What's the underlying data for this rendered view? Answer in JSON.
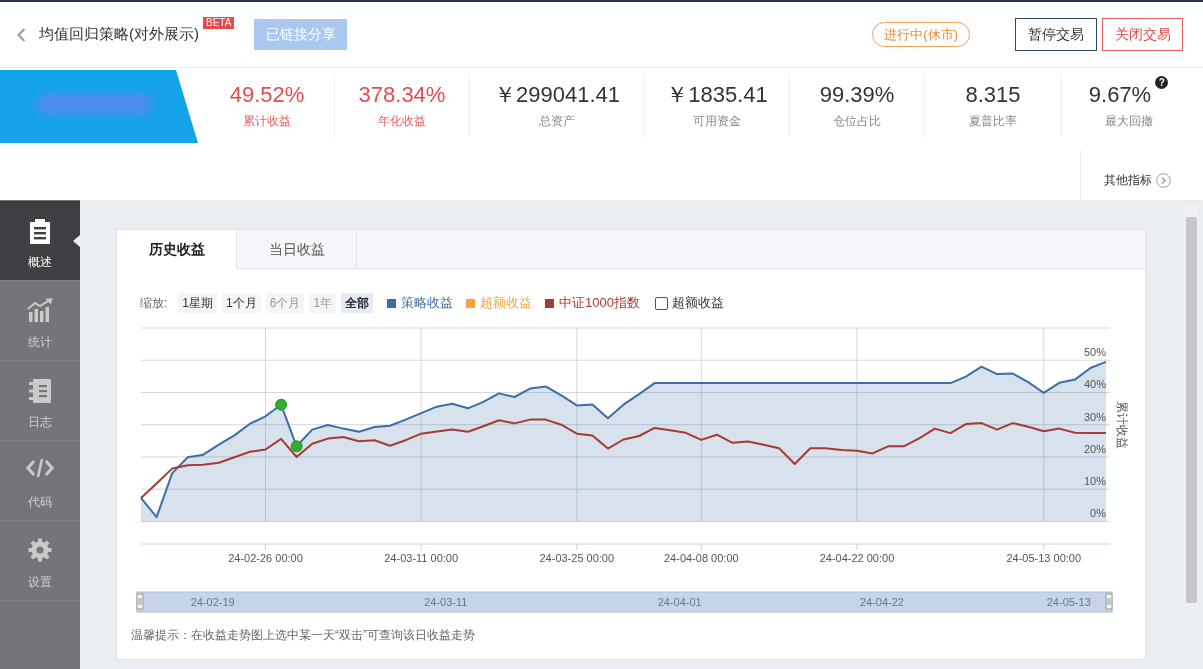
{
  "header": {
    "title": "均值回归策略(对外展示)",
    "badge": "BETA",
    "share_button": "已链接分享",
    "status": "进行中(休市)",
    "buttons": [
      {
        "label": "暂停交易",
        "kind": "outline"
      },
      {
        "label": "关闭交易",
        "kind": "danger"
      }
    ]
  },
  "metrics": [
    {
      "value": "49.52%",
      "label": "累计收益",
      "highlight": true
    },
    {
      "value": "378.34%",
      "label": "年化收益",
      "highlight": true
    },
    {
      "value": "￥299041.41",
      "label": "总资产",
      "highlight": false
    },
    {
      "value": "￥1835.41",
      "label": "可用资金",
      "highlight": false
    },
    {
      "value": "99.39%",
      "label": "仓位占比",
      "highlight": false
    },
    {
      "value": "8.315",
      "label": "夏普比率",
      "highlight": false
    },
    {
      "value": "9.67%",
      "label": "最大回撤",
      "highlight": false,
      "help": "?"
    }
  ],
  "other_metrics": "其他指标",
  "sidebar": [
    {
      "label": "概述",
      "selected": true
    },
    {
      "label": "统计",
      "selected": false
    },
    {
      "label": "日志",
      "selected": false
    },
    {
      "label": "代码",
      "selected": false
    },
    {
      "label": "设置",
      "selected": false
    }
  ],
  "chart_panel": {
    "tabs": [
      {
        "label": "历史收益",
        "selected": true
      },
      {
        "label": "当日收益",
        "selected": false
      }
    ],
    "zoom_label": "缩放:",
    "zoom_options": [
      {
        "label": "1星期",
        "selected": false,
        "disabled": false
      },
      {
        "label": "1个月",
        "selected": false,
        "disabled": false
      },
      {
        "label": "6个月",
        "selected": false,
        "disabled": true
      },
      {
        "label": "1年",
        "selected": false,
        "disabled": true
      },
      {
        "label": "全部",
        "selected": true,
        "disabled": false
      }
    ],
    "toggle": {
      "label": "超额收益",
      "checked": false
    },
    "chart_data": {
      "type": "line",
      "ylabel": "累计收益",
      "grid": true,
      "categories": [
        null,
        null,
        null,
        null,
        null,
        null,
        null,
        null,
        "24-02-26 00:00",
        null,
        null,
        null,
        null,
        null,
        null,
        null,
        null,
        null,
        "24-03-11 00:00",
        null,
        null,
        null,
        null,
        null,
        null,
        null,
        null,
        null,
        "24-03-25 00:00",
        null,
        null,
        null,
        null,
        null,
        null,
        null,
        "24-04-08 00:00",
        null,
        null,
        null,
        null,
        null,
        null,
        null,
        null,
        null,
        "24-04-22 00:00",
        null,
        null,
        null,
        null,
        null,
        null,
        null,
        null,
        null,
        null,
        null,
        "24-05-13 00:00",
        null,
        null,
        null,
        null
      ],
      "series": [
        {
          "name": "策略收益",
          "color": "#3d6ea5",
          "type": "area",
          "values": [
            7.3,
            1.3,
            14.9,
            19.9,
            20.7,
            23.8,
            26.7,
            30.3,
            32.6,
            36.2,
            23.3,
            28.5,
            29.9,
            28.8,
            27.8,
            29.3,
            29.7,
            31.6,
            33.6,
            35.6,
            36.5,
            35.1,
            37.1,
            39.7,
            38.6,
            41.2,
            41.9,
            39.1,
            36.0,
            36.3,
            32.0,
            36.2,
            39.5,
            42.9,
            42.9,
            42.9,
            42.9,
            42.9,
            42.9,
            42.9,
            42.9,
            42.9,
            42.9,
            42.9,
            42.9,
            42.9,
            42.9,
            42.9,
            42.9,
            42.9,
            42.9,
            42.9,
            42.9,
            44.9,
            48.0,
            45.7,
            45.9,
            43.2,
            39.9,
            43.0,
            44.0,
            47.6,
            49.5
          ]
        },
        {
          "name": "超额收益",
          "color": "#f2a43a",
          "type": "line",
          "values": [
            null,
            null,
            null,
            null,
            null,
            null,
            null,
            null,
            null,
            null,
            null,
            null,
            null,
            null,
            null,
            null,
            null,
            null,
            null,
            null,
            null,
            null,
            null,
            null,
            null,
            null,
            null,
            null,
            null,
            null,
            null,
            null,
            null,
            null,
            null,
            null,
            null,
            null,
            null,
            null,
            null,
            null,
            null,
            null,
            null,
            null,
            null,
            null,
            null,
            null,
            null,
            null,
            null,
            null,
            null,
            null,
            null,
            null,
            null,
            null,
            null,
            null,
            null
          ]
        },
        {
          "name": "中证1000指数",
          "color": "#a63a35",
          "type": "line",
          "values": [
            7.3,
            11.8,
            16.4,
            17.4,
            17.6,
            18.2,
            19.9,
            21.6,
            22.3,
            25.6,
            20.0,
            24.1,
            25.7,
            26.2,
            24.9,
            25.2,
            23.5,
            25.2,
            27.2,
            27.9,
            28.5,
            27.8,
            29.5,
            31.4,
            30.4,
            31.6,
            31.6,
            30.0,
            27.2,
            26.7,
            22.6,
            25.4,
            26.5,
            29.0,
            28.3,
            27.5,
            25.3,
            26.9,
            24.4,
            24.8,
            23.8,
            22.7,
            17.8,
            22.7,
            22.7,
            22.2,
            21.9,
            21.1,
            23.3,
            23.3,
            25.8,
            28.8,
            27.4,
            30.2,
            30.5,
            28.5,
            30.5,
            29.4,
            28.0,
            28.8,
            27.5,
            27.4,
            27.4
          ]
        }
      ],
      "ylim": [
        -7,
        60
      ],
      "yticks": [
        {
          "value": 0,
          "label": "0%"
        },
        {
          "value": 10,
          "label": "10%"
        },
        {
          "value": 20,
          "label": "20%"
        },
        {
          "value": 30,
          "label": "30%"
        },
        {
          "value": 40,
          "label": "40%"
        },
        {
          "value": 50,
          "label": "50%"
        }
      ]
    },
    "navigator_labels": [
      "24-02-19",
      "24-03-11",
      "24-04-01",
      "24-04-22",
      "24-05-13"
    ],
    "hint": "温馨提示：在收益走势图上选中某一天“双击”可查询该日收益走势"
  }
}
